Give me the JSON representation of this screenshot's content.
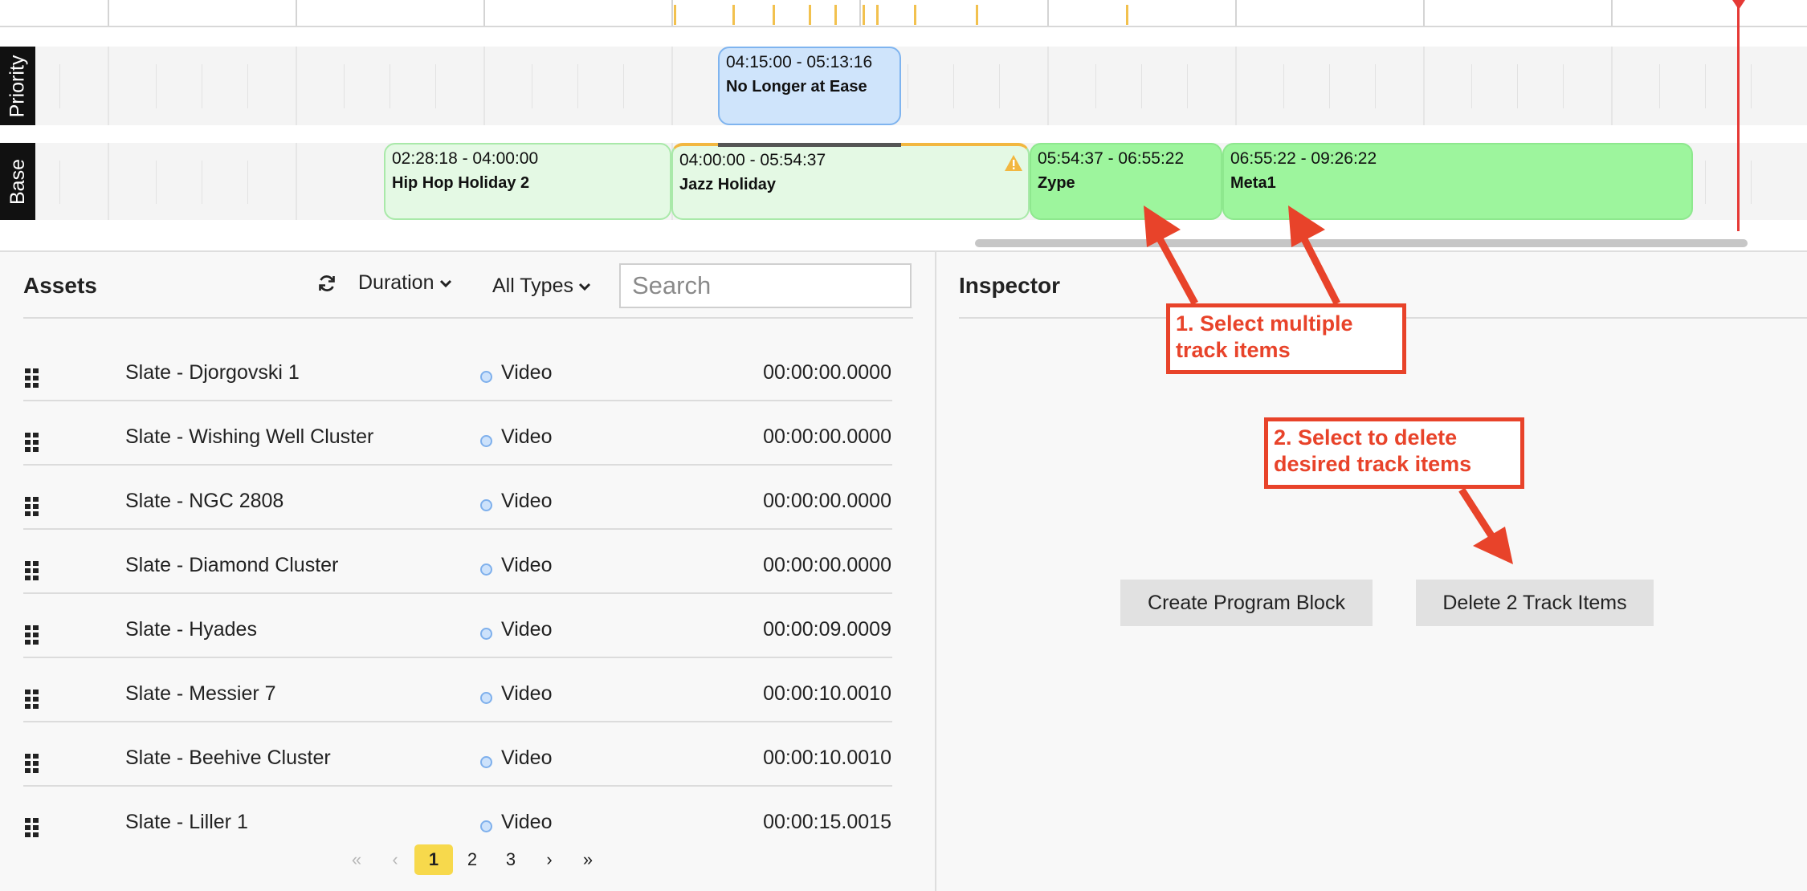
{
  "colors": {
    "accent_yellow": "#f7d94c",
    "clip_green_light": "#e4f9e4",
    "clip_green_solid": "#9df59d",
    "clip_blue": "#cfe4fb",
    "playhead_red": "#e53935",
    "annotation_red": "#e8432a"
  },
  "timeline": {
    "tracks": {
      "priority_label": "Priority",
      "base_label": "Base"
    },
    "priority_clip": {
      "time": "04:15:00 - 05:13:16",
      "name": "No Longer at Ease"
    },
    "base_clips": [
      {
        "time": "02:28:18 - 04:00:00",
        "name": "Hip Hop Holiday 2",
        "selected": false
      },
      {
        "time": "04:00:00 - 05:54:37",
        "name": "Jazz Holiday",
        "selected": false,
        "warning": true
      },
      {
        "time": "05:54:37 - 06:55:22",
        "name": "Zype",
        "selected": true
      },
      {
        "time": "06:55:22 - 09:26:22",
        "name": "Meta1",
        "selected": true
      }
    ]
  },
  "assets": {
    "title": "Assets",
    "sort_label": "Duration",
    "type_filter": "All Types",
    "search_placeholder": "Search",
    "rows": [
      {
        "name": "Slate - Djorgovski 1",
        "type": "Video",
        "duration": "00:00:00.0000"
      },
      {
        "name": "Slate - Wishing Well Cluster",
        "type": "Video",
        "duration": "00:00:00.0000"
      },
      {
        "name": "Slate - NGC 2808",
        "type": "Video",
        "duration": "00:00:00.0000"
      },
      {
        "name": "Slate - Diamond Cluster",
        "type": "Video",
        "duration": "00:00:00.0000"
      },
      {
        "name": "Slate - Hyades",
        "type": "Video",
        "duration": "00:00:09.0009"
      },
      {
        "name": "Slate - Messier 7",
        "type": "Video",
        "duration": "00:00:10.0010"
      },
      {
        "name": "Slate - Beehive Cluster",
        "type": "Video",
        "duration": "00:00:10.0010"
      },
      {
        "name": "Slate - Liller 1",
        "type": "Video",
        "duration": "00:00:15.0015"
      }
    ],
    "pagination": {
      "first": "«",
      "prev": "‹",
      "pages": [
        "1",
        "2",
        "3"
      ],
      "current_page": "1",
      "next": "›",
      "last": "»"
    }
  },
  "inspector": {
    "title": "Inspector",
    "create_button": "Create Program Block",
    "delete_button": "Delete 2 Track Items"
  },
  "annotations": {
    "step1_line1": "1. Select multiple",
    "step1_line2": "track items",
    "step2_line1": "2. Select to delete",
    "step2_line2": "desired track items"
  }
}
